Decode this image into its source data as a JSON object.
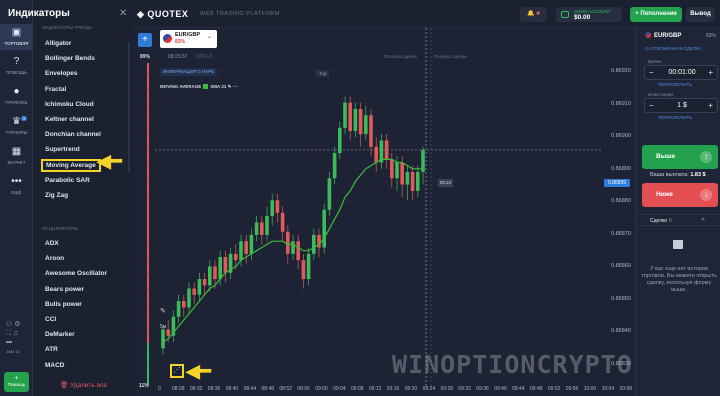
{
  "rail": {
    "items": [
      {
        "label": "ТОРГОВЛЯ",
        "icon": "chart-icon"
      },
      {
        "label": "ПОМОЩЬ",
        "icon": "help-icon"
      },
      {
        "label": "ПРОФИЛЬ",
        "icon": "profile-icon"
      },
      {
        "label": "ТУРНИРЫ",
        "icon": "trophy-icon",
        "badge": "3"
      },
      {
        "label": "МАРКЕТ",
        "icon": "market-icon"
      },
      {
        "label": "ЕЩЁ",
        "icon": "more-icon"
      }
    ],
    "bottom_labels": [
      "JAM 13"
    ],
    "help_button": "Помощь"
  },
  "indicators": {
    "title": "Индикаторы",
    "section_trend": "ИНДИКАТОРЫ ТРЕНДА",
    "trend_items": [
      "Alligator",
      "Bollinger Bends",
      "Envelopes",
      "Fractal",
      "Ichimoku Cloud",
      "Keltner channel",
      "Donchian channel",
      "Supertrend",
      "Moving Average",
      "Parabolic SAR",
      "Zig Zag"
    ],
    "highlighted": "Moving Average",
    "section_osc": "ОСЦИЛЛЯТОРЫ",
    "osc_items": [
      "ADX",
      "Aroon",
      "Awesome Oscillator",
      "Bears power",
      "Bulls power",
      "CCI",
      "DeMarker",
      "ATR",
      "MACD"
    ],
    "delete_all": "Удалить все"
  },
  "header": {
    "logo": "QUOTEX",
    "tagline": "WEB TRADING PLATFORM",
    "balance_label": "DEMO ACCOUNT",
    "balance": "$0.00",
    "deposit": "Пополнение",
    "withdraw": "Вывод"
  },
  "chart": {
    "asset": "EUR/GBP",
    "asset_pct": "83%",
    "time": "09:23:37",
    "timezone": "UTC+3",
    "info_badge": "ИНФОРМАЦИЯ О ПАРЕ",
    "legend": "MOVING AVERAGE",
    "legend_type": "SMA",
    "legend_period": "21",
    "pct_top": "89%",
    "pct_bottom": "11%",
    "close_label_1": "Покупка сделки",
    "close_label_2": "Покупка сделки",
    "top_tag": "Тор",
    "timer": "00:24",
    "watermark": "WINOPTIONCRYPTO.COM",
    "current_price": "0.86899",
    "accent": "#2f7bd8",
    "ma_color": "#3dbb3d"
  },
  "chart_data": {
    "type": "candlestick",
    "price_axis": [
      "0.86920",
      "0.86910",
      "0.86900",
      "0.86890",
      "0.86880",
      "0.86870",
      "0.86860",
      "0.86850",
      "0.86840",
      "0.86830"
    ],
    "time_axis": [
      "0",
      "08:28",
      "08:32",
      "08:36",
      "08:40",
      "08:44",
      "08:48",
      "08:52",
      "08:56",
      "09:00",
      "09:04",
      "09:08",
      "09:12",
      "09:16",
      "09:20",
      "09:24",
      "09:28",
      "09:32",
      "09:36",
      "09:40",
      "09:44",
      "09:48",
      "09:52",
      "09:56",
      "10:00",
      "10:04",
      "10:08",
      "10:12",
      "10:16"
    ],
    "ylim": [
      0.86825,
      0.86925
    ],
    "candles": [
      [
        0.86836,
        0.86842,
        0.86834,
        0.86843
      ],
      [
        0.86842,
        0.8684,
        0.86838,
        0.86845
      ],
      [
        0.8684,
        0.86846,
        0.86838,
        0.86848
      ],
      [
        0.86846,
        0.86851,
        0.86844,
        0.86853
      ],
      [
        0.86851,
        0.86849,
        0.86846,
        0.86853
      ],
      [
        0.86849,
        0.86855,
        0.86847,
        0.86857
      ],
      [
        0.86855,
        0.86853,
        0.8685,
        0.86857
      ],
      [
        0.86853,
        0.86858,
        0.86851,
        0.8686
      ],
      [
        0.86858,
        0.86856,
        0.86853,
        0.8686
      ],
      [
        0.86856,
        0.86862,
        0.86854,
        0.86864
      ],
      [
        0.86862,
        0.86858,
        0.86855,
        0.86864
      ],
      [
        0.86858,
        0.86865,
        0.86856,
        0.86867
      ],
      [
        0.86865,
        0.8686,
        0.86857,
        0.86867
      ],
      [
        0.8686,
        0.86866,
        0.86858,
        0.86868
      ],
      [
        0.86866,
        0.86864,
        0.86861,
        0.86869
      ],
      [
        0.86864,
        0.8687,
        0.86862,
        0.86872
      ],
      [
        0.8687,
        0.86866,
        0.86863,
        0.86872
      ],
      [
        0.86866,
        0.86872,
        0.86864,
        0.86874
      ],
      [
        0.86872,
        0.86876,
        0.8687,
        0.86878
      ],
      [
        0.86876,
        0.86872,
        0.86869,
        0.86878
      ],
      [
        0.86872,
        0.86878,
        0.8687,
        0.86881
      ],
      [
        0.86878,
        0.86883,
        0.86875,
        0.86885
      ],
      [
        0.86883,
        0.86879,
        0.86876,
        0.86885
      ],
      [
        0.86879,
        0.86873,
        0.8687,
        0.86881
      ],
      [
        0.86873,
        0.86866,
        0.86863,
        0.86875
      ],
      [
        0.86866,
        0.8687,
        0.86864,
        0.86872
      ],
      [
        0.8687,
        0.86864,
        0.86861,
        0.86872
      ],
      [
        0.86864,
        0.86858,
        0.86855,
        0.86866
      ],
      [
        0.86858,
        0.86866,
        0.86856,
        0.86868
      ],
      [
        0.86866,
        0.86872,
        0.86864,
        0.86874
      ],
      [
        0.86872,
        0.86868,
        0.86865,
        0.86874
      ],
      [
        0.86868,
        0.8688,
        0.86866,
        0.86882
      ],
      [
        0.8688,
        0.8689,
        0.86878,
        0.86892
      ],
      [
        0.8689,
        0.86898,
        0.86888,
        0.869
      ],
      [
        0.86898,
        0.86906,
        0.86896,
        0.86908
      ],
      [
        0.86906,
        0.86914,
        0.86904,
        0.86916
      ],
      [
        0.86914,
        0.86905,
        0.86902,
        0.86916
      ],
      [
        0.86905,
        0.86912,
        0.86903,
        0.86914
      ],
      [
        0.86912,
        0.86904,
        0.869,
        0.86914
      ],
      [
        0.86904,
        0.8691,
        0.86902,
        0.86913
      ],
      [
        0.8691,
        0.869,
        0.86897,
        0.86912
      ],
      [
        0.869,
        0.86895,
        0.86892,
        0.86903
      ],
      [
        0.86895,
        0.86902,
        0.86893,
        0.86904
      ],
      [
        0.86902,
        0.86896,
        0.86893,
        0.86904
      ],
      [
        0.86896,
        0.8689,
        0.86887,
        0.86898
      ],
      [
        0.8689,
        0.86895,
        0.86886,
        0.86897
      ],
      [
        0.86895,
        0.86888,
        0.86884,
        0.86897
      ],
      [
        0.86888,
        0.86892,
        0.86883,
        0.86894
      ],
      [
        0.86892,
        0.86886,
        0.86883,
        0.86894
      ],
      [
        0.86886,
        0.86892,
        0.86884,
        0.86894
      ],
      [
        0.86892,
        0.86899,
        0.86888,
        0.869
      ]
    ],
    "ma": [
      0.86838,
      0.86839,
      0.86841,
      0.86843,
      0.86845,
      0.86847,
      0.86849,
      0.86851,
      0.86853,
      0.86855,
      0.86856,
      0.86858,
      0.8686,
      0.86861,
      0.86862,
      0.86864,
      0.86865,
      0.86866,
      0.86867,
      0.86868,
      0.86869,
      0.8687,
      0.8687,
      0.8687,
      0.86869,
      0.86869,
      0.86868,
      0.86867,
      0.86867,
      0.86868,
      0.86869,
      0.86871,
      0.86874,
      0.86877,
      0.8688,
      0.86884,
      0.86886,
      0.86889,
      0.86891,
      0.86893,
      0.86894,
      0.86895,
      0.86896,
      0.86896,
      0.86896,
      0.86895,
      0.86895,
      0.86894,
      0.86893,
      0.86893,
      0.86893
    ]
  },
  "trade": {
    "asset": "EUR/GBP",
    "asset_pct": "83%",
    "pending": "ОТЛОЖЕННАЯ СДЕЛКА",
    "time_label": "Время",
    "time_value": "00:01:00",
    "time_link": "ПЕРЕКЛЮЧИТЬ",
    "amount_label": "Инвестиция",
    "amount_value": "1 $",
    "amount_link": "ПЕРЕКЛЮЧИТЬ",
    "up": "Выше",
    "down": "Ниже",
    "payout_label": "Ваша выплата:",
    "payout_value": "1.83 $",
    "deals_title": "Сделки",
    "deals_count": "0",
    "deals_empty": "У вас еще нет истории торговли. Вы можете открыть сделку, используя форму выше."
  }
}
